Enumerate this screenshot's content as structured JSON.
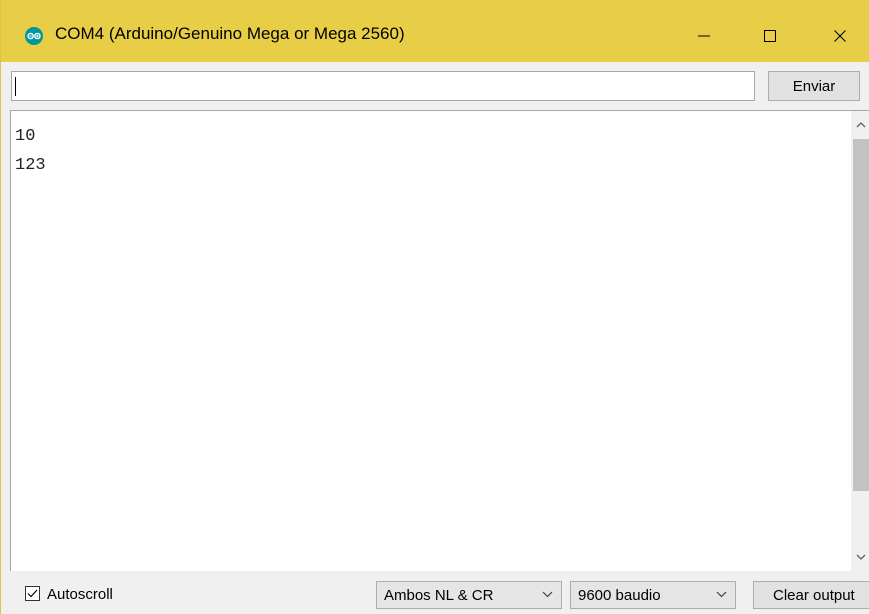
{
  "window": {
    "title": "COM4 (Arduino/Genuino Mega or Mega 2560)",
    "icon": "arduino-logo-icon",
    "controls": [
      "minimize-icon",
      "maximize-icon",
      "close-icon"
    ]
  },
  "send": {
    "input_value": "",
    "button_label": "Enviar"
  },
  "output": {
    "lines": [
      "10",
      "123"
    ]
  },
  "footer": {
    "autoscroll_label": "Autoscroll",
    "autoscroll_checked": true,
    "line_ending": "Ambos NL & CR",
    "baud_rate": "9600 baudio",
    "clear_label": "Clear output"
  },
  "colors": {
    "titlebar": "#e8ce47",
    "arduino_teal": "#00979c",
    "scroll_thumb": "#c2c2c2"
  }
}
